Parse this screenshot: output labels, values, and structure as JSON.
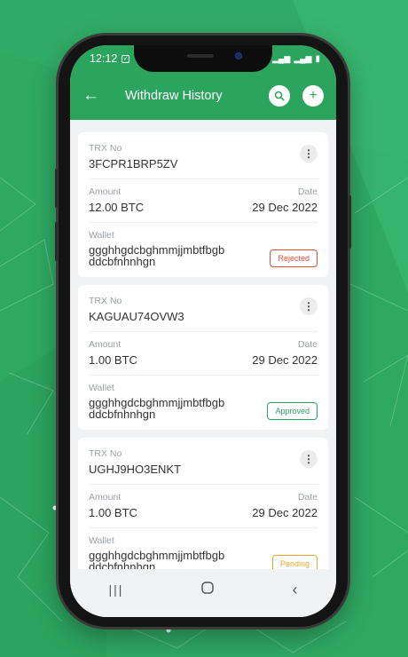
{
  "status": {
    "time": "12:12"
  },
  "appbar": {
    "title": "Withdraw History"
  },
  "labels": {
    "trx": "TRX No",
    "amount": "Amount",
    "date": "Date",
    "wallet": "Wallet"
  },
  "transactions": [
    {
      "trx": "3FCPR1BRP5ZV",
      "amount": "12.00 BTC",
      "date": "29 Dec 2022",
      "wallet": "ggghhgdcbghmmjjmbtfbgb ddcbfnhnhgn",
      "status": "Rejected"
    },
    {
      "trx": "KAGUAU74OVW3",
      "amount": "1.00 BTC",
      "date": "29 Dec 2022",
      "wallet": "ggghhgdcbghmmjjmbtfbgb ddcbfnhnhgn",
      "status": "Approved"
    },
    {
      "trx": "UGHJ9HO3ENKT",
      "amount": "1.00 BTC",
      "date": "29 Dec 2022",
      "wallet": "ggghhgdcbghmmjjmbtfbgb ddcbfnhnhgn",
      "status": "Pending"
    }
  ],
  "icons": {
    "back": "arrow-left-icon",
    "search": "search-icon",
    "add": "plus-icon",
    "more": "more-vertical-icon",
    "recents": "recents-icon",
    "home": "home-icon",
    "nav_back": "nav-back-icon"
  },
  "colors": {
    "brand": "#2ba55d",
    "rejected": "#e34a3b",
    "approved": "#2ba55d",
    "pending": "#e6a927"
  }
}
